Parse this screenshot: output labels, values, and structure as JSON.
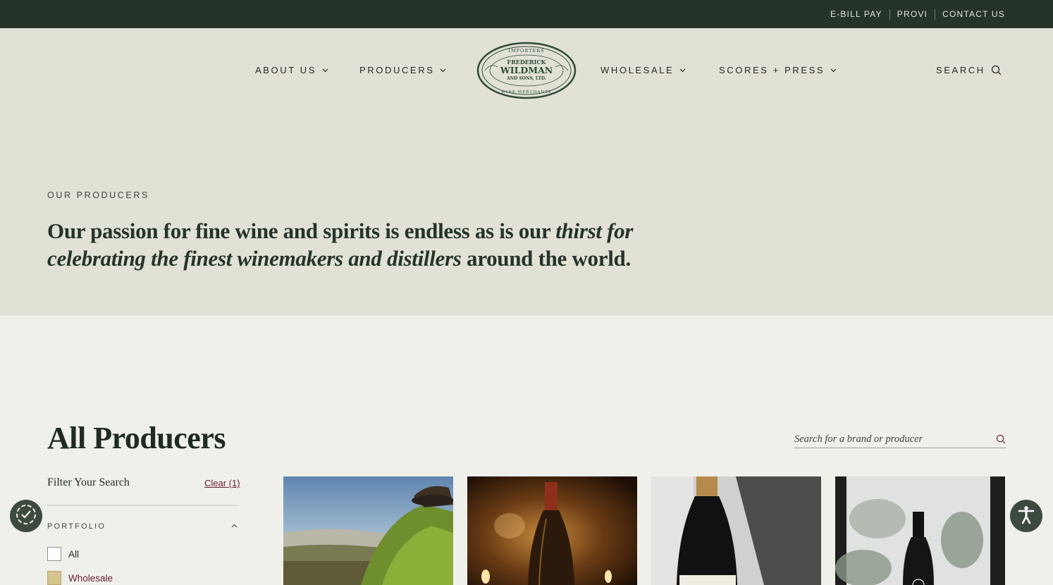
{
  "utility_bar": {
    "links": [
      "E-BILL PAY",
      "PROVI",
      "CONTACT US"
    ]
  },
  "nav": {
    "about": "ABOUT US",
    "producers": "PRODUCERS",
    "wholesale": "WHOLESALE",
    "scores": "SCORES + PRESS",
    "search": "SEARCH"
  },
  "logo": {
    "line1": "IMPORTERS",
    "line2": "FREDERICK",
    "line3": "WILDMAN",
    "line4": "AND SONS, LTD.",
    "line5": "WINE MERCHANTS"
  },
  "hero": {
    "eyebrow": "OUR PRODUCERS",
    "head_part1": "Our passion for fine wine and spirits is endless as is our ",
    "head_italic": "thirst for celebrating the finest winemakers and distillers",
    "head_part2": " around the world."
  },
  "producers": {
    "title": "All Producers",
    "search_placeholder": "Search for a brand or producer",
    "filter_title": "Filter Your Search",
    "clear_label": "Clear (1)",
    "group_label": "PORTFOLIO",
    "options": [
      {
        "label": "All",
        "checked": false
      },
      {
        "label": "Wholesale",
        "checked": true
      }
    ]
  },
  "colors": {
    "utility_bar": "#253329",
    "hero_bg": "#e1e1d6",
    "page_bg": "#f0f0eb",
    "accent_link": "#6a2233",
    "checked_fill": "#d4c48e"
  },
  "icons": {
    "badge_left": "accessibility-consent-icon",
    "badge_right": "accessibility-person-icon"
  }
}
